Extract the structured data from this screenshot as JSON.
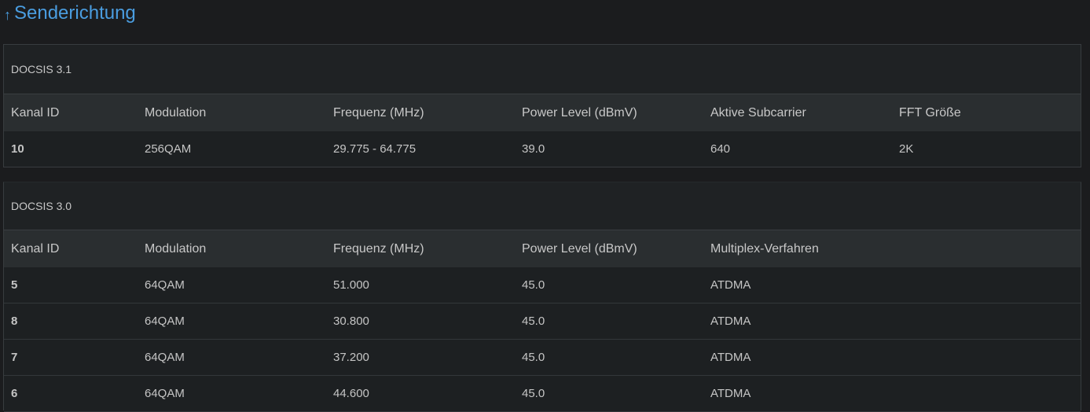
{
  "section": {
    "arrow_icon": "arrow-up-icon",
    "arrow_glyph": "↑",
    "title": "Senderichtung",
    "accent_color": "#4a9de0"
  },
  "docsis31": {
    "title": "DOCSIS 3.1",
    "columns": [
      "Kanal ID",
      "Modulation",
      "Frequenz (MHz)",
      "Power Level (dBmV)",
      "Aktive Subcarrier",
      "FFT Größe"
    ],
    "rows": [
      [
        "10",
        "256QAM",
        "29.775 - 64.775",
        "39.0",
        "640",
        "2K"
      ]
    ]
  },
  "docsis30": {
    "title": "DOCSIS 3.0",
    "columns": [
      "Kanal ID",
      "Modulation",
      "Frequenz (MHz)",
      "Power Level (dBmV)",
      "Multiplex-Verfahren"
    ],
    "rows": [
      [
        "5",
        "64QAM",
        "51.000",
        "45.0",
        "ATDMA"
      ],
      [
        "8",
        "64QAM",
        "30.800",
        "45.0",
        "ATDMA"
      ],
      [
        "7",
        "64QAM",
        "37.200",
        "45.0",
        "ATDMA"
      ],
      [
        "6",
        "64QAM",
        "44.600",
        "45.0",
        "ATDMA"
      ]
    ]
  }
}
